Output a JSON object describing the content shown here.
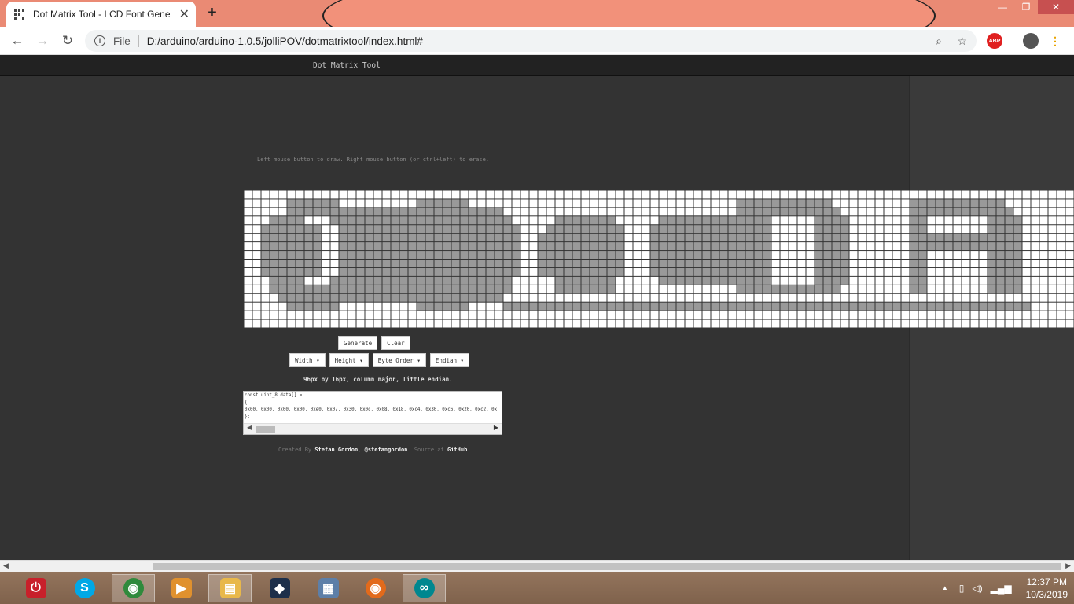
{
  "browser": {
    "tab_title": "Dot Matrix Tool - LCD Font Gene",
    "tab_close": "✕",
    "new_tab": "+",
    "url_scheme_label": "File",
    "url": "D:/arduino/arduino-1.0.5/jolliPOV/dotmatrixtool/index.html#",
    "window_minimize": "—",
    "window_restore": "❐",
    "window_close": "✕",
    "extension_abp": "ABP"
  },
  "app": {
    "title": "Dot Matrix Tool",
    "hint": "Left mouse button to draw. Right mouse button (or ctrl+left) to erase.",
    "buttons": {
      "generate": "Generate",
      "clear": "Clear"
    },
    "dropdowns": [
      {
        "label": "Width"
      },
      {
        "label": "Height"
      },
      {
        "label": "Byte Order"
      },
      {
        "label": "Endian"
      }
    ],
    "summary": "96px by 16px, column major, little endian.",
    "code_lines": [
      "const uint_8 data[] =",
      "{",
      "0x00, 0x00, 0x00, 0x00, 0xe0, 0x07, 0x30, 0x0c, 0x08, 0x18, 0xc4, 0x30, 0xc6, 0x20, 0xc2, 0x",
      "};"
    ],
    "credit": {
      "prefix": "Created By",
      "author": "Stefan Gordon",
      "handle": "@stefangordon",
      "source_text": "Source at",
      "source_link": "GitHub"
    }
  },
  "matrix": {
    "cols": 96,
    "rows": 16,
    "on_cells": "r1:5,6,7,8,9,10,20,21,22,23,24,25,57,58,59,60,61,62,63,64,65,66,67,77,78,79,80,81,82,83,84,85,86,87;r2:5,6,7,8,9,10,11,12,13,14,15,16,17,18,19,20,21,22,23,24,25,26,27,28,29,57,58,59,60,61,62,63,64,65,66,67,68,77,78,79,80,81,82,83,84,85,86,87,88;r3:3,4,5,6,10,11,12,13,14,15,16,17,18,19,20,21,22,23,24,25,26,27,28,29,30,36,37,38,39,40,41,42,48,49,50,51,52,53,54,55,56,57,58,59,60,66,67,68,69,77,78,86,87,88,89;r4:2,3,4,5,6,7,8,11,12,13,14,15,16,17,18,19,20,21,22,23,24,25,26,27,28,29,30,31,35,36,37,38,39,40,41,42,43,47,48,49,50,51,52,53,54,55,56,57,58,59,60,66,67,68,69,77,78,86,87,88,89;r5:2,3,4,5,6,7,8,11,12,13,14,15,16,17,18,19,20,21,22,23,24,25,26,27,28,29,30,31,34,35,36,37,38,39,40,41,42,43,47,48,49,50,51,52,53,54,55,56,57,58,59,60,66,67,68,69,77,78,79,80,81,82,83,84,85,86,87,88,89;r6:2,3,4,5,6,7,8,11,12,13,14,15,16,17,18,19,20,21,22,23,24,25,26,27,28,29,30,31,34,35,36,37,38,39,40,41,42,43,47,48,49,50,51,52,53,54,55,56,57,58,59,60,66,67,68,69,77,78,79,80,81,82,83,84,85,86,87,88,89;r7:2,3,4,5,6,7,8,11,12,13,14,15,16,17,18,19,20,21,22,23,24,25,26,27,28,29,30,31,34,35,36,37,38,39,40,41,42,43,47,48,49,50,51,52,53,54,55,56,57,58,59,60,66,67,68,69,77,78,86,87,88,89;r8:2,3,4,5,6,7,8,11,12,13,14,15,16,17,18,19,20,21,22,23,24,25,26,27,28,29,30,31,34,35,36,37,38,39,40,41,42,43,47,48,49,50,51,52,53,54,55,56,57,58,59,60,66,67,68,69,77,78,86,87,88,89;r9:2,3,4,5,6,7,8,11,12,13,14,15,16,17,18,19,20,21,22,23,24,25,26,27,28,29,30,31,34,35,36,37,38,39,40,41,42,43,47,48,49,50,51,52,53,54,55,56,57,58,59,60,66,67,68,69,77,78,86,87,88,89;r10:3,4,5,6,10,11,12,13,14,15,16,17,18,19,20,21,22,23,24,25,26,27,28,29,30,36,37,38,39,40,41,42,48,49,50,51,52,53,54,55,56,57,58,59,60,66,67,68,69,77,78,86,87,88,89;r11:3,4,5,6,7,8,9,10,11,12,13,14,15,16,17,18,19,20,21,22,23,24,25,26,27,28,29,30,36,37,38,39,40,41,42,57,58,59,60,61,62,63,64,65,66,67,68,77,78,86,87,88,89;r12:4,5,6,7,8,9,10,11,12,13,14,15,16,17,18,19,20,21,22,23,24,25,26,27,28,29;r13:5,6,7,8,9,10,20,21,22,23,24,25,30,31,32,33,34,35,36,37,38,39,40,41,42,43,44,45,46,47,48,49,50,51,52,53,54,55,56,57,58,59,60,61,62,63,64,65,66,67,68,69,70,71,72,73,74,75,76,77,78,79,80,81,82,83,84,85,86,87,88,89,90"
  },
  "window_scrollbar": {
    "left_arrow": "◀",
    "right_arrow": "▶"
  },
  "code_scrollbar": {
    "left_arrow": "◀",
    "right_arrow": "▶"
  },
  "taskbar": {
    "apps": [
      {
        "name": "power-app",
        "glyph": "⏻",
        "color": "#c8202a"
      },
      {
        "name": "skype",
        "glyph": "S",
        "color": "#00a8e6"
      },
      {
        "name": "chrome",
        "glyph": "◉",
        "color": "#2f8a3c"
      },
      {
        "name": "media-player",
        "glyph": "▶",
        "color": "#e0912e"
      },
      {
        "name": "file-explorer",
        "glyph": "▤",
        "color": "#e8b84a"
      },
      {
        "name": "creative-app",
        "glyph": "◆",
        "color": "#1d2f4a"
      },
      {
        "name": "calculator",
        "glyph": "▦",
        "color": "#5d7fa8"
      },
      {
        "name": "firefox",
        "glyph": "◉",
        "color": "#e26a1b"
      },
      {
        "name": "arduino",
        "glyph": "∞",
        "color": "#00878f"
      }
    ],
    "tray_arrow": "▲",
    "time": "12:37 PM",
    "date": "10/3/2019"
  },
  "colors": {
    "cell_on": "#999999",
    "cell_off": "#ffffff",
    "grid_line": "#333333",
    "tab_bar": "#ea8a74"
  }
}
